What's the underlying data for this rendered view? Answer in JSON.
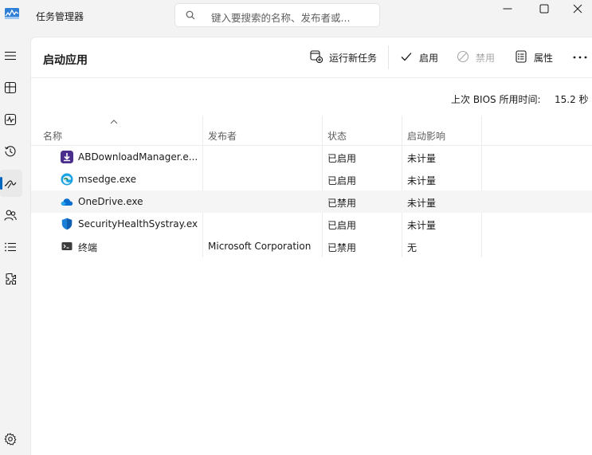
{
  "window": {
    "title": "任务管理器",
    "search_placeholder": "键入要搜索的名称、发布者或..."
  },
  "sidebar": {
    "items": [
      {
        "name": "menu-icon"
      },
      {
        "name": "processes-icon"
      },
      {
        "name": "performance-icon"
      },
      {
        "name": "app-history-icon"
      },
      {
        "name": "startup-apps-icon",
        "active": true
      },
      {
        "name": "users-icon"
      },
      {
        "name": "details-icon"
      },
      {
        "name": "services-icon"
      },
      {
        "name": "settings-icon"
      }
    ]
  },
  "page": {
    "title": "启动应用",
    "bios_label": "上次 BIOS 所用时间:",
    "bios_value": "15.2 秒"
  },
  "toolbar": {
    "run_new_task": "运行新任务",
    "enable": "启用",
    "disable": "禁用",
    "properties": "属性"
  },
  "table": {
    "columns": {
      "name": "名称",
      "publisher": "发布者",
      "status": "状态",
      "impact": "启动影响"
    },
    "rows": [
      {
        "name": "ABDownloadManager.e...",
        "publisher": "",
        "status": "已启用",
        "impact": "未计量",
        "icon": "abdm-icon",
        "icon_color": "#4a2f8c"
      },
      {
        "name": "msedge.exe",
        "publisher": "",
        "status": "已启用",
        "impact": "未计量",
        "icon": "edge-icon",
        "icon_color": "#1ba3e2"
      },
      {
        "name": "OneDrive.exe",
        "publisher": "",
        "status": "已禁用",
        "impact": "未计量",
        "icon": "onedrive-icon",
        "icon_color": "#0a6ed1"
      },
      {
        "name": "SecurityHealthSystray.exe",
        "publisher": "",
        "status": "已启用",
        "impact": "未计量",
        "icon": "shield-icon",
        "icon_color": "#1b7fd6"
      },
      {
        "name": "终端",
        "publisher": "Microsoft Corporation",
        "status": "已禁用",
        "impact": "无",
        "icon": "terminal-icon",
        "icon_color": "#3b3b3b"
      }
    ]
  },
  "colors": {
    "accent": "#0067c0",
    "background": "#f3f3f3",
    "panel": "#ffffff"
  }
}
